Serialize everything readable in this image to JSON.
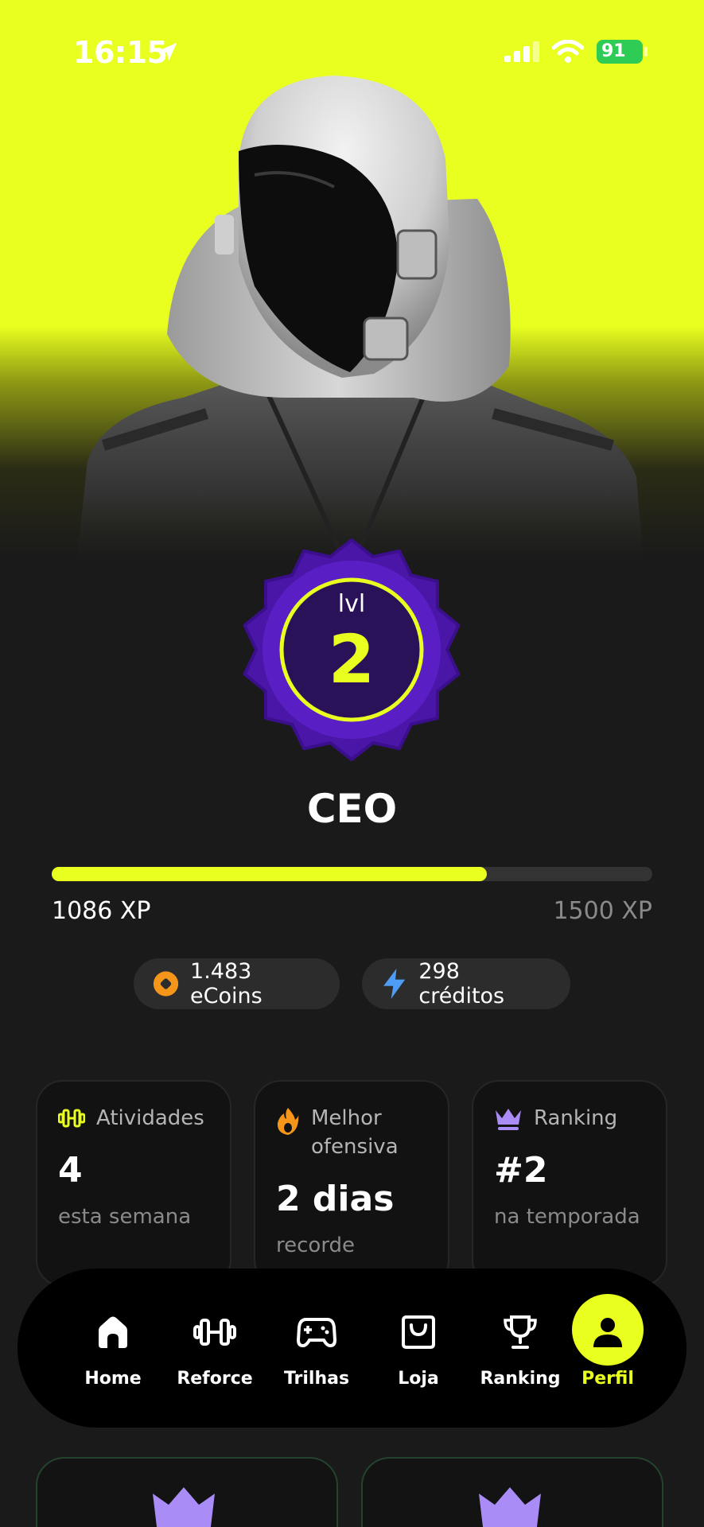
{
  "status_bar": {
    "time": "16:15",
    "battery": "91"
  },
  "level": {
    "label": "lvl",
    "number": "2"
  },
  "role_title": "CEO",
  "xp": {
    "current_label": "1086 XP",
    "target_label": "1500 XP",
    "progress": 0.724
  },
  "wallet": {
    "coins_label": "1.483 eCoins",
    "credits_label": "298 créditos"
  },
  "stats": [
    {
      "title": "Atividades",
      "value": "4",
      "caption": "esta semana"
    },
    {
      "title": "Melhor ofensiva",
      "value": "2 dias",
      "caption": "recorde"
    },
    {
      "title": "Ranking",
      "value": "#2",
      "caption": "na temporada"
    }
  ],
  "nav": {
    "items": [
      {
        "label": "Home",
        "icon": "home-icon"
      },
      {
        "label": "Reforce",
        "icon": "dumbbell-icon"
      },
      {
        "label": "Trilhas",
        "icon": "gamepad-icon"
      },
      {
        "label": "Loja",
        "icon": "shopping-bag-icon"
      },
      {
        "label": "Ranking",
        "icon": "trophy-icon"
      },
      {
        "label": "Perfil",
        "icon": "user-icon"
      }
    ],
    "active": "Perfil"
  },
  "colors": {
    "accent": "#e8ff1f",
    "badge_purple": "#4a16a8",
    "background": "#1a1a1a",
    "coin_orange": "#f5961b",
    "credit_blue": "#4f9cf5",
    "crown_purple": "#a98cf5"
  }
}
